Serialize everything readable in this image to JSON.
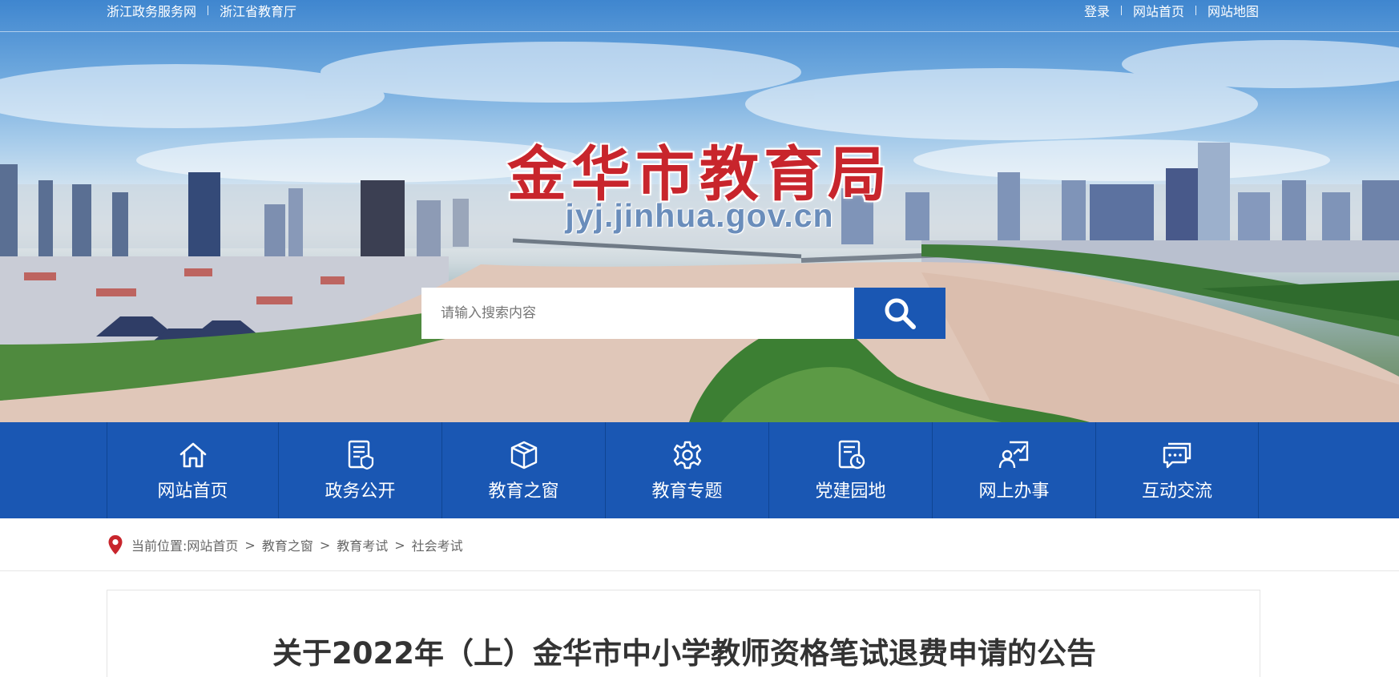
{
  "topbar": {
    "left_links": [
      "浙江政务服务网",
      "浙江省教育厅"
    ],
    "right_links": [
      "登录",
      "网站首页",
      "网站地图"
    ]
  },
  "banner": {
    "title": "金华市教育局",
    "domain": "jyj.jinhua.gov.cn",
    "title_color": "#c8252c"
  },
  "search": {
    "placeholder": "请输入搜索内容",
    "button_icon": "search-icon"
  },
  "nav": {
    "accent": "#1a57b3",
    "items": [
      {
        "label": "网站首页",
        "icon": "home-icon"
      },
      {
        "label": "政务公开",
        "icon": "document-shield-icon"
      },
      {
        "label": "教育之窗",
        "icon": "box-icon"
      },
      {
        "label": "教育专题",
        "icon": "gear-icon"
      },
      {
        "label": "党建园地",
        "icon": "document-clock-icon"
      },
      {
        "label": "网上办事",
        "icon": "person-chart-icon"
      },
      {
        "label": "互动交流",
        "icon": "chat-icon"
      }
    ]
  },
  "breadcrumb": {
    "prefix": "当前位置:",
    "items": [
      "网站首页",
      "教育之窗",
      "教育考试",
      "社会考试"
    ],
    "separator": ">"
  },
  "article": {
    "title": "关于2022年（上）金华市中小学教师资格笔试退费申请的公告"
  }
}
